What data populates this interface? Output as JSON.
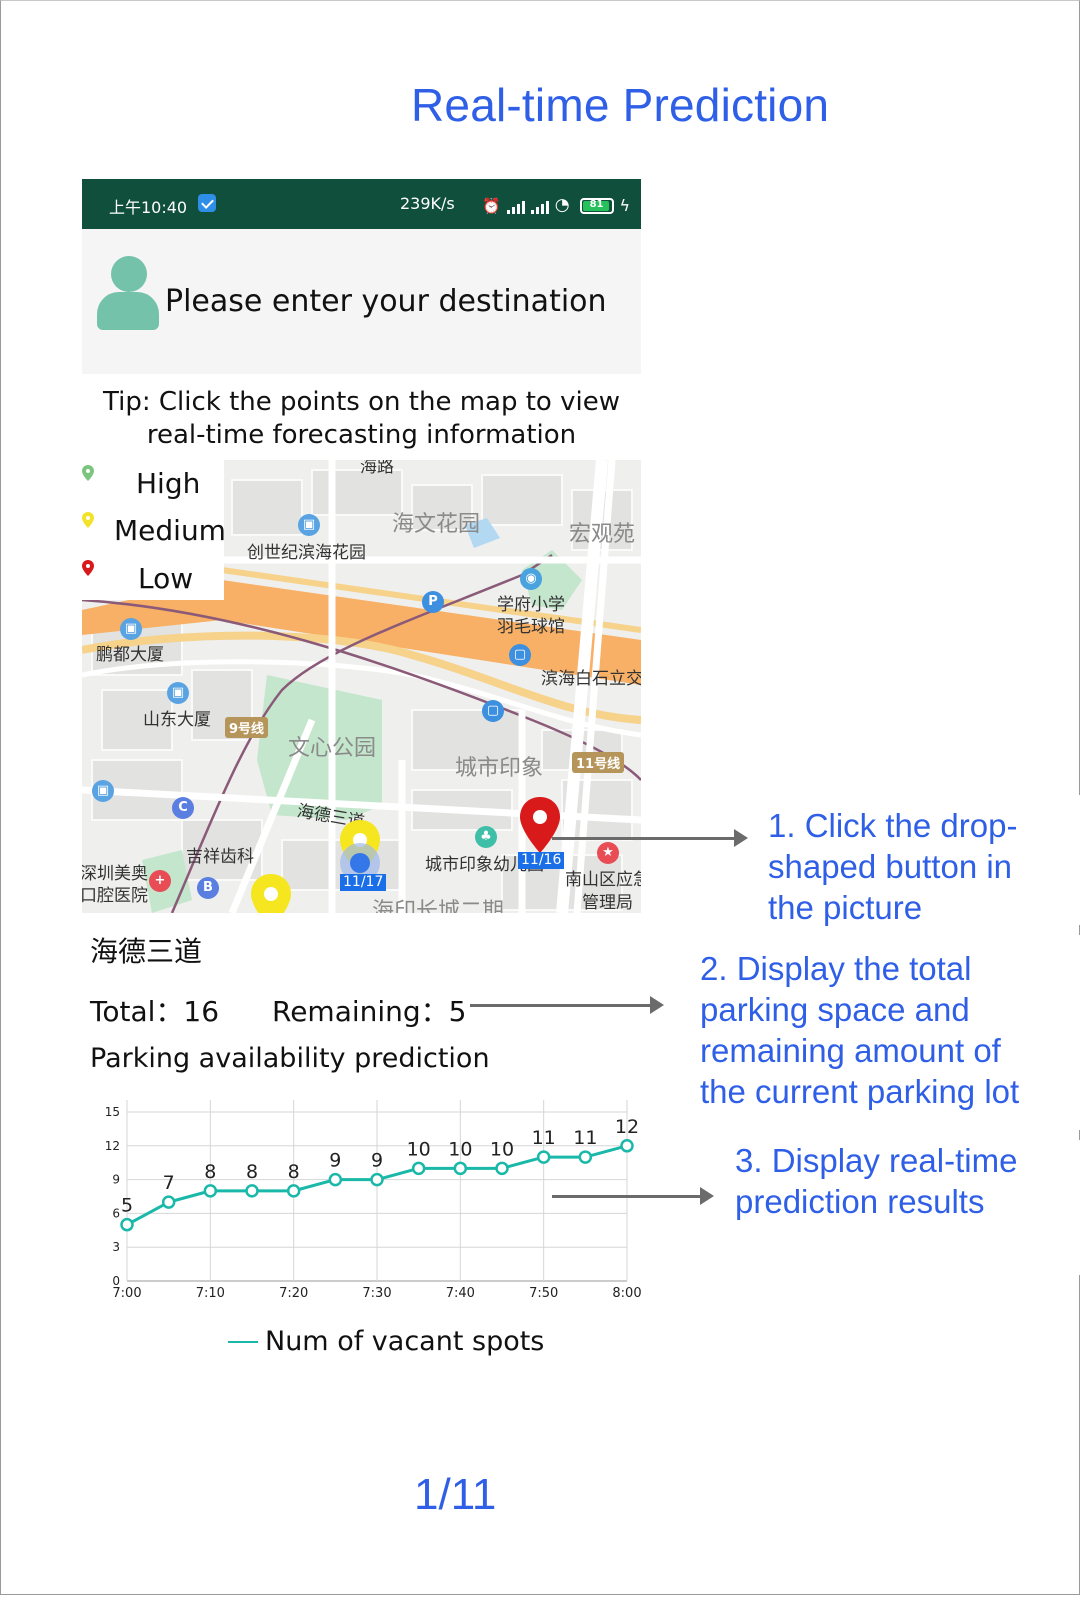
{
  "header": {
    "title": "Real-time Prediction"
  },
  "status_bar": {
    "time": "上午10:40",
    "speed": "239K/s",
    "battery": "81"
  },
  "destination": {
    "placeholder": "Please enter your destination"
  },
  "tip": {
    "line1": "Tip: Click the points on the map to view",
    "line2": "real-time forecasting information"
  },
  "legend": [
    {
      "label": "High",
      "color": "#7cc57f"
    },
    {
      "label": "Medium",
      "color": "#f3e12a"
    },
    {
      "label": "Low",
      "color": "#d7191c"
    }
  ],
  "map": {
    "labels": {
      "road_top": "海路",
      "haiwen": "海文花园",
      "hongguan": "宏观苑",
      "chuangshiji": "创世纪滨海花园",
      "xuefu1": "学府小学",
      "xuefu2": "羽毛球馆",
      "pengdu": "鹏都大厦",
      "binhai": "滨海白石立交",
      "shandong": "山东大厦",
      "line9": "9号线",
      "wenxin": "文心公园",
      "chengshi": "城市印象",
      "line11": "11号线",
      "haide": "海德三道",
      "jixiang": "吉祥齿科",
      "chengshiyou": "城市印象幼儿园",
      "nanshan1": "南山区应急",
      "nanshan2": "管理局",
      "shenzhen1": "深圳美奥",
      "shenzhen2": "口腔医院",
      "haiyin": "海印长城二期",
      "tag_1116": "11/16",
      "tag_1117": "11/17"
    }
  },
  "lot": {
    "name": "海德三道",
    "total": "Total：16",
    "remaining": "Remaining：5"
  },
  "prediction": {
    "title": "Parking availability prediction"
  },
  "chart_data": {
    "type": "line",
    "x": [
      "7:00",
      "7:05",
      "7:10",
      "7:15",
      "7:20",
      "7:25",
      "7:30",
      "7:35",
      "7:40",
      "7:45",
      "7:50",
      "7:55",
      "8:00"
    ],
    "x_tick_labels": [
      "7:00",
      "7:10",
      "7:20",
      "7:30",
      "7:40",
      "7:50",
      "8:00"
    ],
    "series": [
      {
        "name": "Num of vacant spots",
        "values": [
          5,
          7,
          8,
          8,
          8,
          9,
          9,
          10,
          10,
          10,
          11,
          11,
          12
        ],
        "color": "#1ab8a9"
      }
    ],
    "y_ticks": [
      0,
      3,
      6,
      9,
      12,
      15
    ],
    "ylim": [
      0,
      15
    ],
    "grid": true,
    "legend": "bottom"
  },
  "annotations": [
    {
      "lines": [
        "1. Click the drop-",
        "shaped button in",
        "the picture"
      ]
    },
    {
      "lines": [
        "2. Display the total",
        "parking space and",
        "remaining amount of",
        "the current parking lot"
      ]
    },
    {
      "lines": [
        "3. Display real-time",
        "prediction results"
      ]
    }
  ],
  "footer": {
    "page": "1/11"
  }
}
